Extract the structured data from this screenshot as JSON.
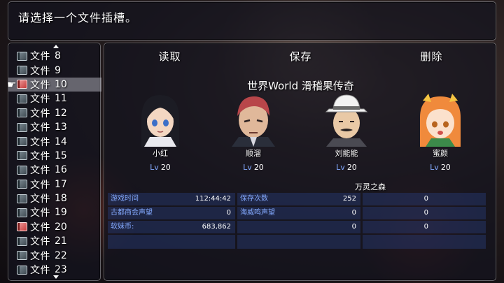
{
  "help": {
    "text": "请选择一个文件插槽。"
  },
  "file_list": {
    "prefix": "文件",
    "rows": [
      {
        "num": "8",
        "saved": false,
        "selected": false
      },
      {
        "num": "9",
        "saved": false,
        "selected": false
      },
      {
        "num": "10",
        "saved": true,
        "selected": true
      },
      {
        "num": "11",
        "saved": false,
        "selected": false
      },
      {
        "num": "12",
        "saved": false,
        "selected": false
      },
      {
        "num": "13",
        "saved": false,
        "selected": false
      },
      {
        "num": "14",
        "saved": false,
        "selected": false
      },
      {
        "num": "15",
        "saved": false,
        "selected": false
      },
      {
        "num": "16",
        "saved": false,
        "selected": false
      },
      {
        "num": "17",
        "saved": false,
        "selected": false
      },
      {
        "num": "18",
        "saved": false,
        "selected": false
      },
      {
        "num": "19",
        "saved": false,
        "selected": false
      },
      {
        "num": "20",
        "saved": true,
        "selected": false
      },
      {
        "num": "21",
        "saved": false,
        "selected": false
      },
      {
        "num": "22",
        "saved": false,
        "selected": false
      },
      {
        "num": "23",
        "saved": false,
        "selected": false
      }
    ]
  },
  "commands": {
    "load": "读取",
    "save": "保存",
    "delete": "删除"
  },
  "save_info": {
    "title": "世界World 滑稽果传奇",
    "lv_label": "Lv",
    "map_name": "万灵之森",
    "actors": [
      {
        "name": "小红",
        "level": "20",
        "face": "dark-hair-girl"
      },
      {
        "name": "顺溜",
        "level": "20",
        "face": "red-hair-man"
      },
      {
        "name": "刘能能",
        "level": "20",
        "face": "white-hat-man"
      },
      {
        "name": "蜜颜",
        "level": "20",
        "face": "orange-hair-girl"
      }
    ],
    "stats": {
      "play_time_label": "游戏时间",
      "play_time_value": "112:44:42",
      "guild_label": "古都商会声望",
      "guild_value": "0",
      "coin_label": "软妹币:",
      "coin_value": "683,862",
      "save_count_label": "保存次数",
      "save_count_value": "252",
      "sea_label": "海威鸣声望",
      "sea_value": "0",
      "col2_row3_value": "0",
      "col3_row1_value": "0",
      "col3_row2_value": "0",
      "col3_row3_value": "0"
    }
  },
  "colors": {
    "system_blue": "#84aaff",
    "selected_row": "#c8c8d2"
  }
}
